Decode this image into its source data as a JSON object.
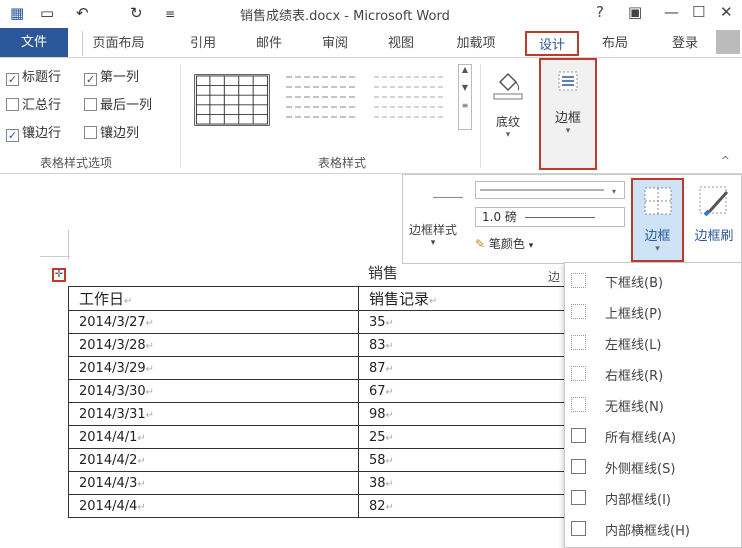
{
  "titlebar": {
    "title": "销售成绩表.docx - Microsoft Word",
    "qa_icons": [
      "word-logo-icon",
      "save-icon",
      "undo-icon",
      "redo-icon",
      "customize-icon"
    ],
    "help": "?",
    "restore": "▣",
    "minimize": "—",
    "maximize": "☐",
    "close": "✕"
  },
  "tabs": {
    "file": "文件",
    "page_layout": "页面布局",
    "references": "引用",
    "mailings": "邮件",
    "review": "审阅",
    "view": "视图",
    "addins": "加载项",
    "design": "设计",
    "layout": "布局",
    "login": "登录"
  },
  "ribbon": {
    "options": {
      "header_row": {
        "label": "标题行",
        "checked": true
      },
      "first_column": {
        "label": "第一列",
        "checked": true
      },
      "total_row": {
        "label": "汇总行",
        "checked": false
      },
      "last_column": {
        "label": "最后一列",
        "checked": false
      },
      "banded_rows": {
        "label": "镶边行",
        "checked": true
      },
      "banded_columns": {
        "label": "镶边列",
        "checked": false
      },
      "group_label": "表格样式选项"
    },
    "styles_group_label": "表格样式",
    "shading_label": "底纹",
    "borders_label": "边框",
    "check_mark": "✓",
    "collapse": "^"
  },
  "border_popup": {
    "style_label": "边框样式",
    "weight": "1.0 磅",
    "pen_color": "笔颜色",
    "borders_label": "边框",
    "painter_label": "边框刷",
    "group_cut": "边"
  },
  "document": {
    "title": "销售",
    "columns": [
      "工作日",
      "销售记录"
    ],
    "rows": [
      [
        "2014/3/27",
        "35"
      ],
      [
        "2014/3/28",
        "83"
      ],
      [
        "2014/3/29",
        "87"
      ],
      [
        "2014/3/30",
        "67"
      ],
      [
        "2014/3/31",
        "98"
      ],
      [
        "2014/4/1",
        "25"
      ],
      [
        "2014/4/2",
        "58"
      ],
      [
        "2014/4/3",
        "38"
      ],
      [
        "2014/4/4",
        "82"
      ]
    ],
    "cell_mark": "↵"
  },
  "border_menu": [
    {
      "label": "下框线(B)",
      "icon": "bottom-border-icon"
    },
    {
      "label": "上框线(P)",
      "icon": "top-border-icon"
    },
    {
      "label": "左框线(L)",
      "icon": "left-border-icon"
    },
    {
      "label": "右框线(R)",
      "icon": "right-border-icon"
    },
    {
      "label": "无框线(N)",
      "icon": "no-border-icon"
    },
    {
      "label": "所有框线(A)",
      "icon": "all-borders-icon"
    },
    {
      "label": "外侧框线(S)",
      "icon": "outside-borders-icon"
    },
    {
      "label": "内部框线(I)",
      "icon": "inside-borders-icon"
    },
    {
      "label": "内部横框线(H)",
      "icon": "inside-horizontal-border-icon"
    }
  ],
  "colors": {
    "accent": "#2b579a",
    "highlight": "#c0392b",
    "selected": "#cfe3f7"
  }
}
